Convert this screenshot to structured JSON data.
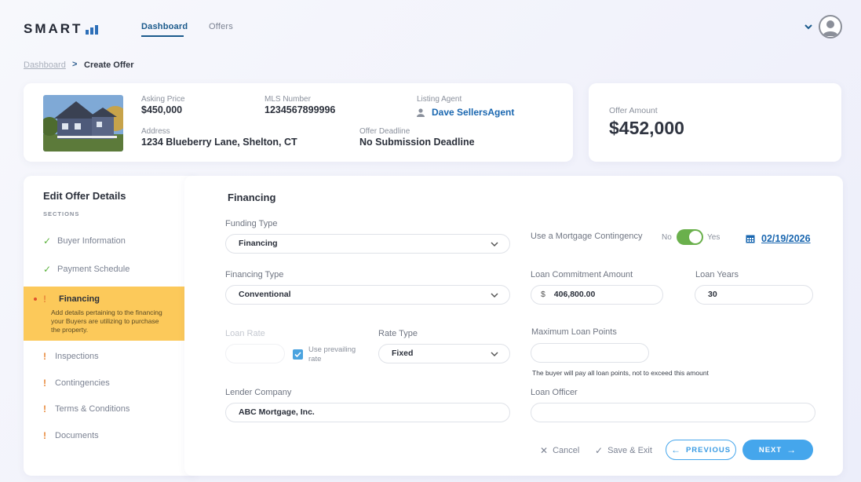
{
  "header": {
    "logo_text": "SMART",
    "tabs": [
      {
        "label": "Dashboard",
        "active": true
      },
      {
        "label": "Offers",
        "active": false
      }
    ]
  },
  "breadcrumb": {
    "parent": "Dashboard",
    "separator": ">",
    "current": "Create Offer"
  },
  "property": {
    "asking_price_label": "Asking Price",
    "asking_price": "$450,000",
    "mls_label": "MLS Number",
    "mls": "1234567899996",
    "agent_label": "Listing Agent",
    "agent": "Dave SellersAgent",
    "address_label": "Address",
    "address": "1234 Blueberry Lane, Shelton, CT",
    "deadline_label": "Offer Deadline",
    "deadline": "No Submission Deadline"
  },
  "offer": {
    "label": "Offer Amount",
    "amount": "$452,000"
  },
  "sidebar": {
    "title": "Edit Offer Details",
    "sections_label": "SECTIONS",
    "items": [
      {
        "label": "Buyer Information",
        "status": "complete"
      },
      {
        "label": "Payment Schedule",
        "status": "complete"
      },
      {
        "label": "Financing",
        "status": "active",
        "description": "Add details pertaining to the financing your Buyers are utilizing to purchase the property."
      },
      {
        "label": "Inspections",
        "status": "incomplete"
      },
      {
        "label": "Contingencies",
        "status": "incomplete"
      },
      {
        "label": "Terms & Conditions",
        "status": "incomplete"
      },
      {
        "label": "Documents",
        "status": "incomplete"
      }
    ]
  },
  "form": {
    "section_title": "Financing",
    "funding_type_label": "Funding Type",
    "funding_type": "Financing",
    "mortgage_contingency_label": "Use a Mortgage Contingency",
    "toggle_no": "No",
    "toggle_yes": "Yes",
    "toggle_on": true,
    "contingency_date": "02/19/2026",
    "financing_type_label": "Financing Type",
    "financing_type": "Conventional",
    "loan_commitment_label": "Loan Commitment Amount",
    "currency_symbol": "$",
    "loan_commitment": "406,800.00",
    "loan_years_label": "Loan Years",
    "loan_years": "30",
    "loan_rate_label": "Loan Rate",
    "loan_rate": "",
    "use_prevailing_label": "Use prevailing rate",
    "use_prevailing_checked": true,
    "rate_type_label": "Rate Type",
    "rate_type": "Fixed",
    "max_points_label": "Maximum Loan Points",
    "max_points": "",
    "points_note": "The buyer will pay all loan points, not to exceed this amount",
    "lender_label": "Lender Company",
    "lender": "ABC Mortgage, Inc.",
    "officer_label": "Loan Officer",
    "officer": ""
  },
  "actions": {
    "cancel": "Cancel",
    "save_exit": "Save & Exit",
    "previous": "PREVIOUS",
    "next": "NEXT"
  },
  "colors": {
    "accent": "#45a6ec",
    "brand": "#1b5a8c",
    "active_section": "#fcc95a",
    "toggle_on": "#6ab04c"
  }
}
